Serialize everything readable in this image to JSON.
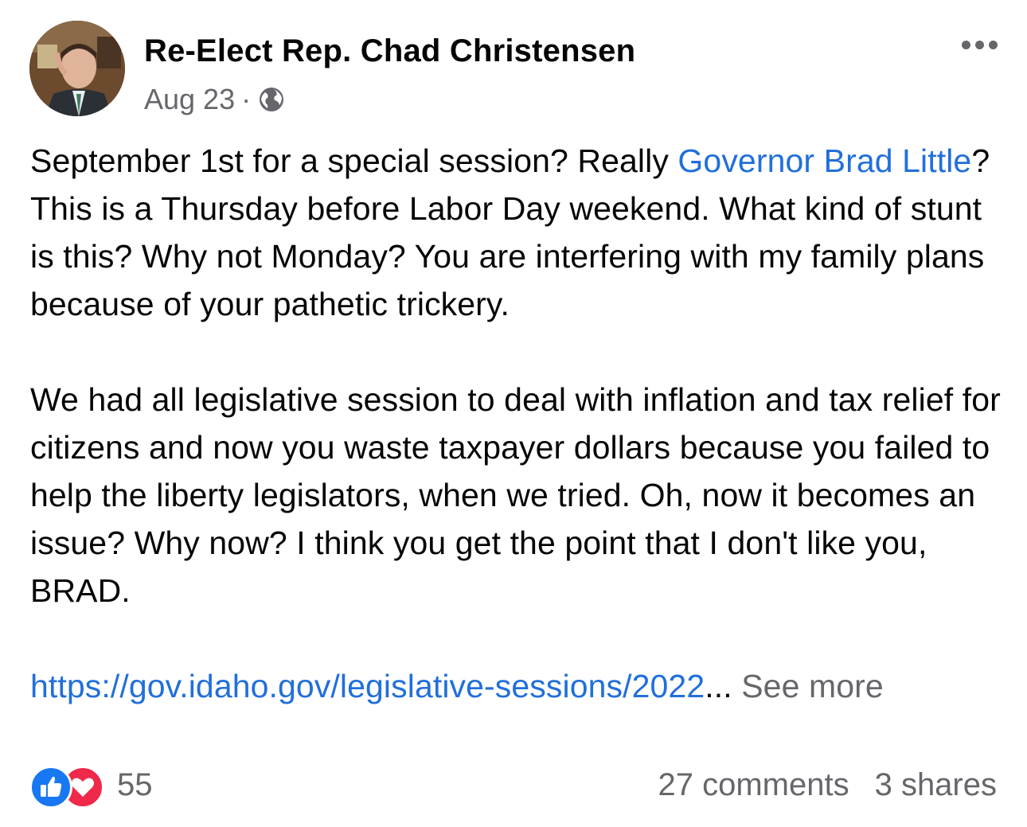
{
  "post": {
    "author": "Re-Elect Rep. Chad Christensen",
    "date": "Aug 23",
    "separator": "·",
    "privacy_icon": "globe-icon",
    "more_icon": "more-options-icon",
    "body": {
      "p1_part1": "September 1st for a special session? Really ",
      "p1_mention": "Governor Brad Little",
      "p1_part2": "? This is a Thursday before Labor Day weekend. What kind of stunt is this? Why not Monday? You are interfering with my family plans because of your pathetic trickery.",
      "p2": "We had all legislative session to deal with inflation and tax relief for citizens and now you waste taxpayer dollars because you failed to help the liberty legislators, when we tried. Oh, now it becomes an issue? Why now? I think you get the point that I don't like you, BRAD.",
      "link": "https://gov.idaho.gov/legislative-sessions/2022",
      "ellipsis": "...",
      "see_more": "See more"
    },
    "reactions": {
      "icons": [
        "like-icon",
        "love-icon"
      ],
      "count": "55"
    },
    "comments": "27 comments",
    "shares": "3 shares"
  },
  "colors": {
    "link": "#216fdb",
    "secondary_text": "#65676b",
    "like": "#1877f2",
    "love": "#f02849"
  }
}
